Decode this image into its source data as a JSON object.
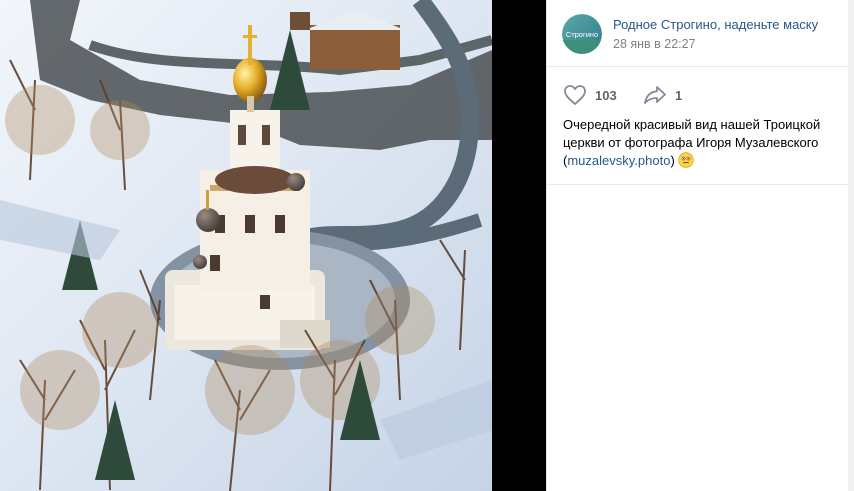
{
  "post": {
    "author": "Родное Строгино, наденьте маску",
    "date": "28 янв в 22:27",
    "avatar_text": "Строгино",
    "likes": "103",
    "shares": "1",
    "text_line": "Очередной красивый вид нашей Троицкой церкви от фотографа Игоря Музалевского",
    "link_open": "(",
    "link_text": "muzalevsky.photo",
    "link_close": ")"
  },
  "icons": [
    "heart-icon",
    "share-icon",
    "emoji-icon"
  ],
  "colors": {
    "link": "#2a5885",
    "muted": "#828282",
    "snow": "#e6eef7",
    "dome_gold": "#e0a920"
  }
}
